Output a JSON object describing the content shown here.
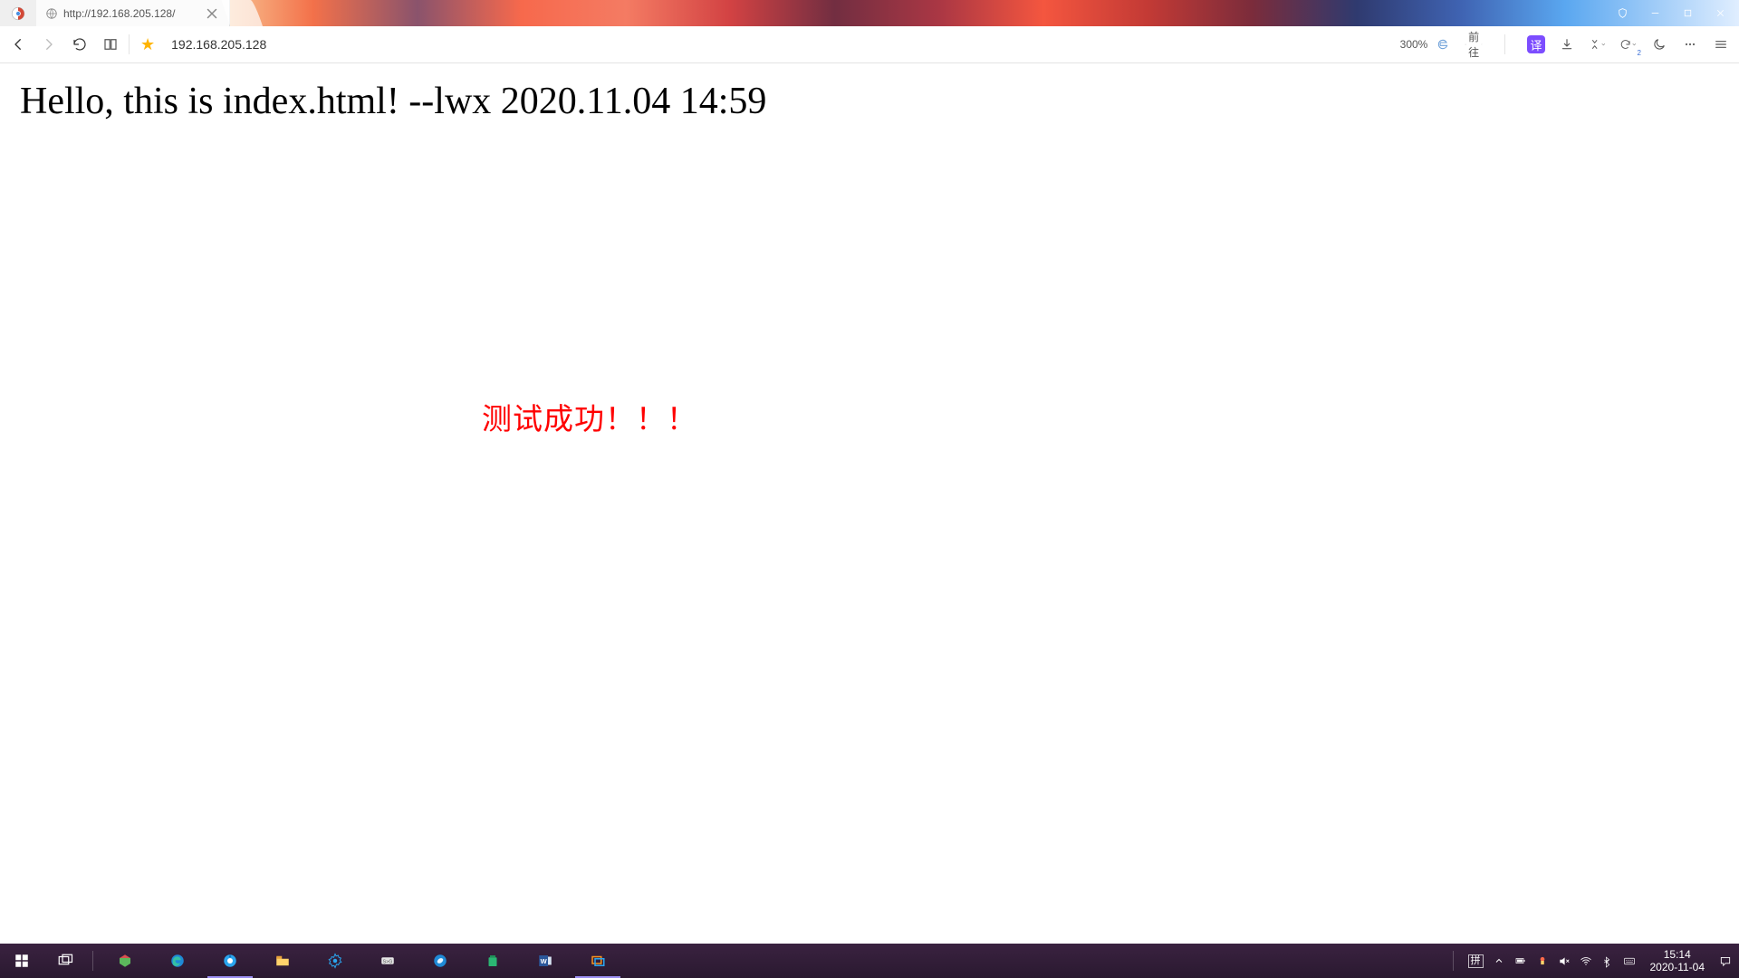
{
  "browser": {
    "tab_url": "http://192.168.205.128/",
    "address_display": "192.168.205.128",
    "zoom_label": "300%",
    "goto_label": "前往",
    "translate_label": "译"
  },
  "page": {
    "heading": "Hello, this is index.html! --lwx 2020.11.04 14:59",
    "centered": "测试成功！！！"
  },
  "taskbar": {
    "ime": "拼",
    "clock_time": "15:14",
    "clock_date": "2020-11-04"
  }
}
